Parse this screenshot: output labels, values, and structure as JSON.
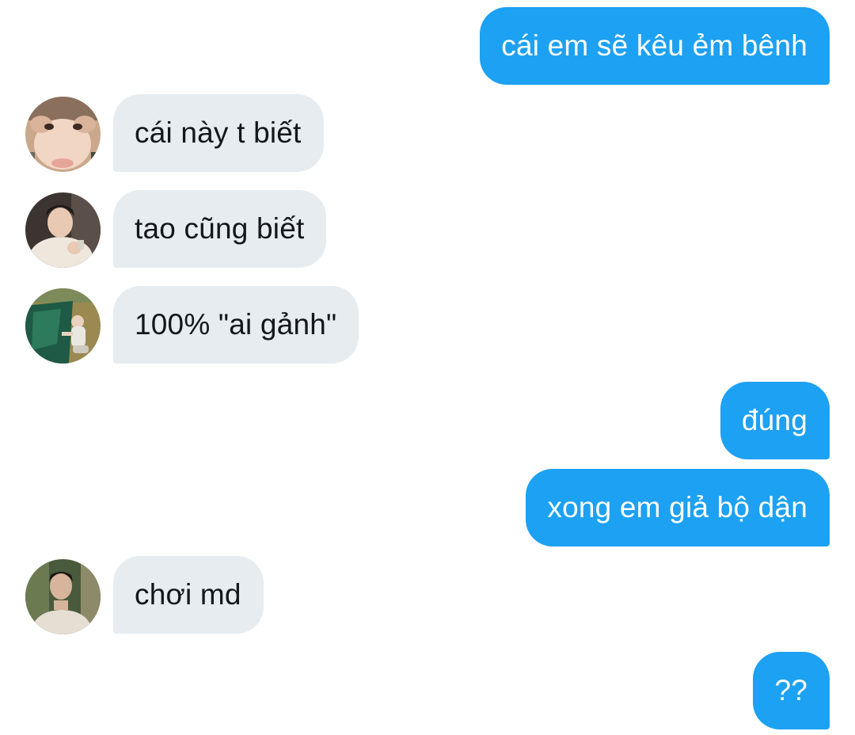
{
  "messages": [
    {
      "side": "out",
      "text": "cái em sẽ kêu ẻm bênh"
    },
    {
      "side": "in",
      "text": "cái này t biết",
      "avatar": "user-photo-1"
    },
    {
      "side": "in",
      "text": "tao cũng biết",
      "avatar": "user-photo-2"
    },
    {
      "side": "in",
      "text": "100% \"ai gảnh\"",
      "avatar": "user-photo-3"
    },
    {
      "side": "out",
      "text": "đúng"
    },
    {
      "side": "out",
      "text": "xong em giả bộ dận"
    },
    {
      "side": "in",
      "text": "chơi md",
      "avatar": "user-photo-4"
    },
    {
      "side": "out",
      "text": "??"
    }
  ],
  "colors": {
    "outgoing_bubble": "#1da1f2",
    "outgoing_text": "#ffffff",
    "incoming_bubble": "#e6ecf0",
    "incoming_text": "#14171a",
    "background": "#ffffff"
  }
}
